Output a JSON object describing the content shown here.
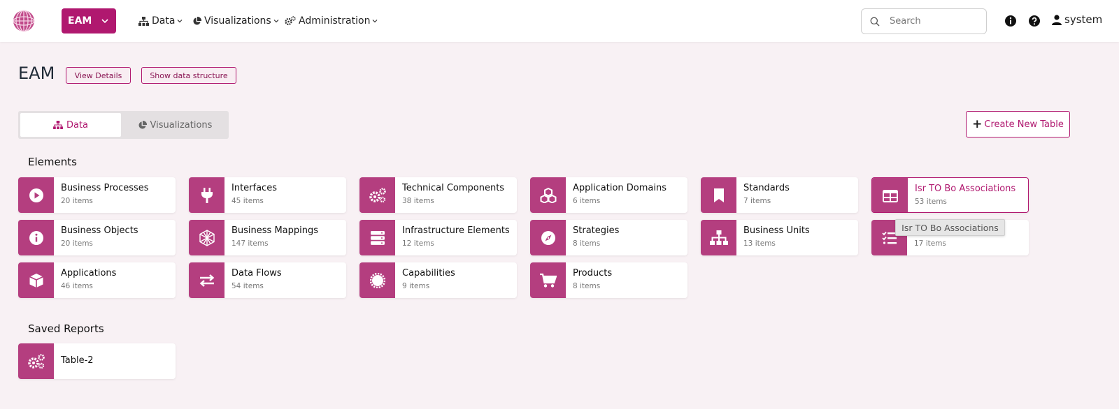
{
  "topbar": {
    "app_switch_label": "EAM",
    "nav": [
      {
        "label": "Data",
        "icon": "sitemap-icon"
      },
      {
        "label": "Visualizations",
        "icon": "pie-chart-icon"
      },
      {
        "label": "Administration",
        "icon": "cogs-icon"
      }
    ],
    "search_placeholder": "Search",
    "user_name": "system"
  },
  "page": {
    "title": "EAM",
    "view_details_label": "View Details",
    "show_structure_label": "Show data structure"
  },
  "tabs": [
    {
      "label": "Data",
      "icon": "sitemap-icon",
      "active": true
    },
    {
      "label": "Visualizations",
      "icon": "pie-chart-icon",
      "active": false
    }
  ],
  "create_button_label": "Create New Table",
  "sections": {
    "elements_title": "Elements",
    "saved_reports_title": "Saved Reports"
  },
  "elements": [
    {
      "name": "Business Processes",
      "count": "20 items",
      "icon": "play-icon"
    },
    {
      "name": "Interfaces",
      "count": "45 items",
      "icon": "plug-icon"
    },
    {
      "name": "Technical Components",
      "count": "38 items",
      "icon": "cogs-icon"
    },
    {
      "name": "Application Domains",
      "count": "6 items",
      "icon": "cubes-icon"
    },
    {
      "name": "Standards",
      "count": "7 items",
      "icon": "bookmark-icon"
    },
    {
      "name": "Isr TO Bo Associations",
      "count": "53 items",
      "icon": "table-icon"
    },
    {
      "name": "Business Objects",
      "count": "20 items",
      "icon": "info-icon"
    },
    {
      "name": "Business Mappings",
      "count": "147 items",
      "icon": "hexagon-icon"
    },
    {
      "name": "Infrastructure Elements",
      "count": "12 items",
      "icon": "server-icon"
    },
    {
      "name": "Strategies",
      "count": "8 items",
      "icon": "compass-icon"
    },
    {
      "name": "Business Units",
      "count": "13 items",
      "icon": "sitemap-icon"
    },
    {
      "name": "",
      "count": "17 items",
      "icon": "list-check-icon"
    },
    {
      "name": "Applications",
      "count": "46 items",
      "icon": "cube-icon"
    },
    {
      "name": "Data Flows",
      "count": "54 items",
      "icon": "exchange-icon"
    },
    {
      "name": "Capabilities",
      "count": "9 items",
      "icon": "certificate-icon"
    },
    {
      "name": "Products",
      "count": "8 items",
      "icon": "cart-icon"
    }
  ],
  "saved_reports": [
    {
      "name": "Table-2",
      "icon": "cogs-icon"
    }
  ],
  "tooltip_text": "Isr TO Bo Associations",
  "colors": {
    "accent": "#b0186f",
    "tile": "#b43e7f",
    "background": "#f8f1f4"
  }
}
